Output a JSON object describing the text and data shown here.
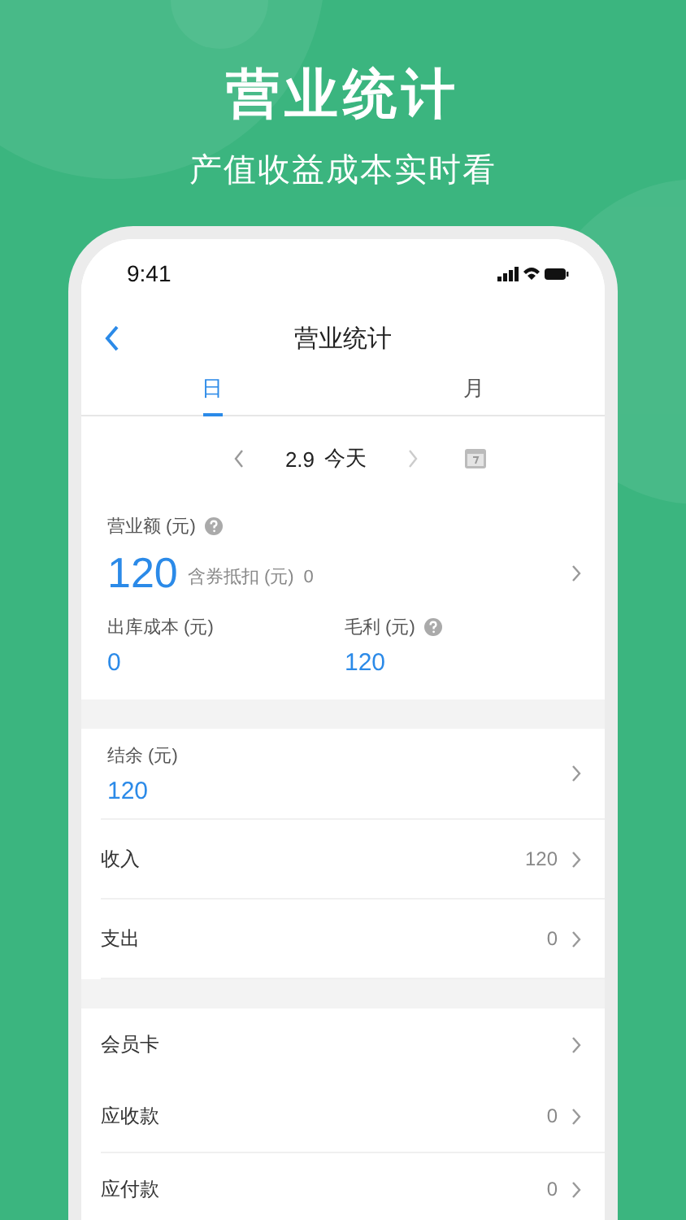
{
  "hero": {
    "title": "营业统计",
    "subtitle": "产值收益成本实时看"
  },
  "status_bar": {
    "time": "9:41"
  },
  "nav": {
    "title": "营业统计"
  },
  "tabs": [
    {
      "label": "日",
      "selected": true
    },
    {
      "label": "月",
      "selected": false
    }
  ],
  "date_picker": {
    "date": "2.9",
    "label": "今天"
  },
  "revenue": {
    "label": "营业额 (元)",
    "value": "120",
    "coupon_label": "含券抵扣 (元)",
    "coupon_value": "0",
    "cost_label": "出库成本 (元)",
    "cost_value": "0",
    "profit_label": "毛利 (元)",
    "profit_value": "120"
  },
  "balance": {
    "label": "结余 (元)",
    "value": "120"
  },
  "groups": [
    {
      "rows": [
        {
          "label": "收入",
          "value": "120"
        },
        {
          "label": "支出",
          "value": "0"
        }
      ]
    },
    {
      "rows": [
        {
          "label": "会员卡"
        },
        {
          "label": "应收款",
          "value": "0"
        },
        {
          "label": "应付款",
          "value": "0"
        }
      ]
    }
  ]
}
